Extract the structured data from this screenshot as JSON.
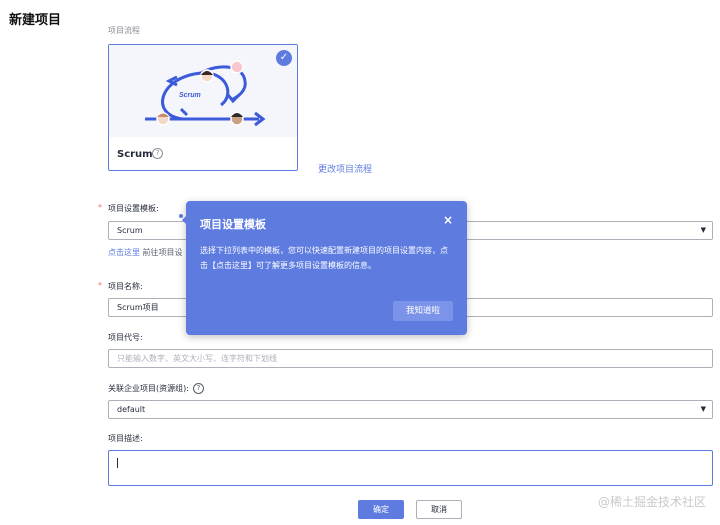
{
  "page": {
    "title": "新建项目"
  },
  "flow": {
    "section_label": "项目流程",
    "card_name": "Scrum",
    "illustration_text": "Scrum",
    "change_link": "更改项目流程"
  },
  "template": {
    "label": "项目设置模板:",
    "value": "Scrum",
    "hint_link": "点击这里",
    "hint_text": " 前往项目设"
  },
  "project_name": {
    "label": "项目名称:",
    "value": "Scrum项目"
  },
  "project_code": {
    "label": "项目代号:",
    "placeholder": "只能输入数字、英文大小写、连字符和下划线"
  },
  "enterprise_project": {
    "label": "关联企业项目(资源组):",
    "value": "default"
  },
  "description": {
    "label": "项目描述:"
  },
  "buttons": {
    "ok": "确定",
    "cancel": "取消"
  },
  "popover": {
    "title": "项目设置模板",
    "body": "选择下拉列表中的模板，您可以快速配置新建项目的项目设置内容，点击【点击这里】可了解更多项目设置模板的信息。",
    "button": "我知道啦",
    "close": "×"
  },
  "watermark": "@稀土掘金技术社区",
  "colors": {
    "accent": "#5e7ce0",
    "required": "#f66f6a"
  }
}
